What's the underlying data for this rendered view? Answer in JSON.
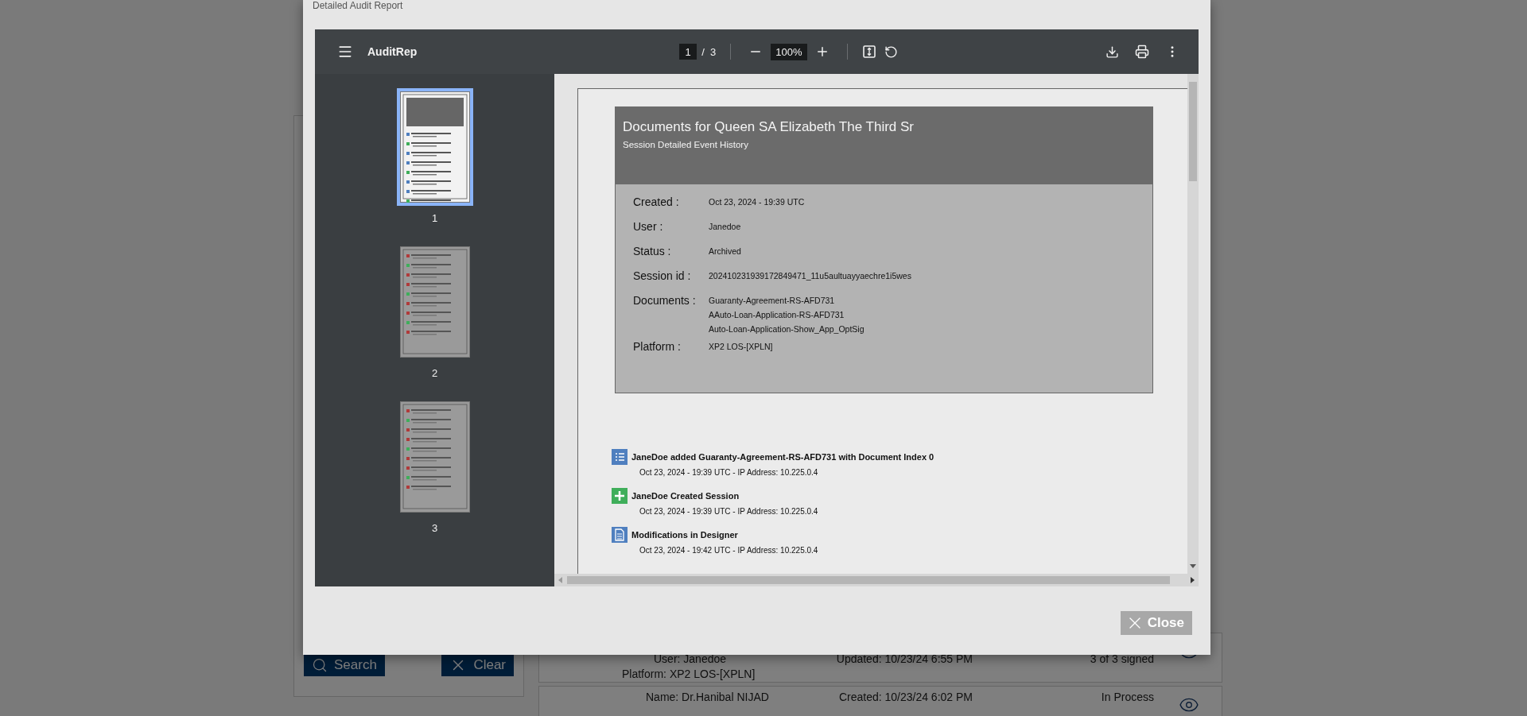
{
  "search_panel": {
    "search_button": "Search",
    "clear_button": "Clear"
  },
  "sessions": {
    "rows": [
      {
        "user": "User:  Janedoe",
        "platform": "Platform: XP2 LOS-[XPLN]",
        "updated": "Updated: 10/23/24 6:55 PM",
        "signed": "3 of 3 signed"
      },
      {
        "name": "Name:  Dr.Hanibal NIJAD",
        "created": "Created: 10/23/24 6:02 PM",
        "status": "In Process"
      }
    ]
  },
  "modal": {
    "title": "Detailed Audit Report",
    "close": "Close",
    "viewer": {
      "title": "AuditRep",
      "page": "1",
      "page_count": "/  3",
      "zoom": "100%",
      "thumbnails": [
        {
          "label": "1",
          "selected": true
        },
        {
          "label": "2",
          "selected": false
        },
        {
          "label": "3",
          "selected": false
        }
      ],
      "document": {
        "heading": "Documents for Queen SA Elizabeth The Third Sr",
        "subheading": "Session Detailed Event History",
        "fields": [
          {
            "label": "Created :",
            "values": [
              "Oct 23, 2024 - 19:39  UTC"
            ]
          },
          {
            "label": "User :",
            "values": [
              "Janedoe"
            ]
          },
          {
            "label": "Status :",
            "values": [
              "Archived"
            ]
          },
          {
            "label": "Session id :",
            "values": [
              "202410231939172849471_11u5aultuayyaechre1i5wes"
            ]
          },
          {
            "label": "Documents :",
            "values": [
              "Guaranty-Agreement-RS-AFD731",
              "AAuto-Loan-Application-RS-AFD731",
              "Auto-Loan-Application-Show_App_OptSig"
            ]
          },
          {
            "label": "Platform :",
            "values": [
              "XP2 LOS-[XPLN]"
            ]
          }
        ],
        "events": [
          {
            "kind": "list",
            "title": "JaneDoe added Guaranty-Agreement-RS-AFD731 with Document Index 0",
            "detail": "Oct 23, 2024 - 19:39  UTC - IP Address: 10.225.0.4"
          },
          {
            "kind": "add",
            "title": "JaneDoe Created Session",
            "detail": "Oct 23, 2024 - 19:39  UTC - IP Address: 10.225.0.4"
          },
          {
            "kind": "document",
            "title": "Modifications in Designer",
            "detail": "Oct 23, 2024 - 19:42  UTC - IP Address: 10.225.0.4"
          }
        ]
      }
    }
  }
}
